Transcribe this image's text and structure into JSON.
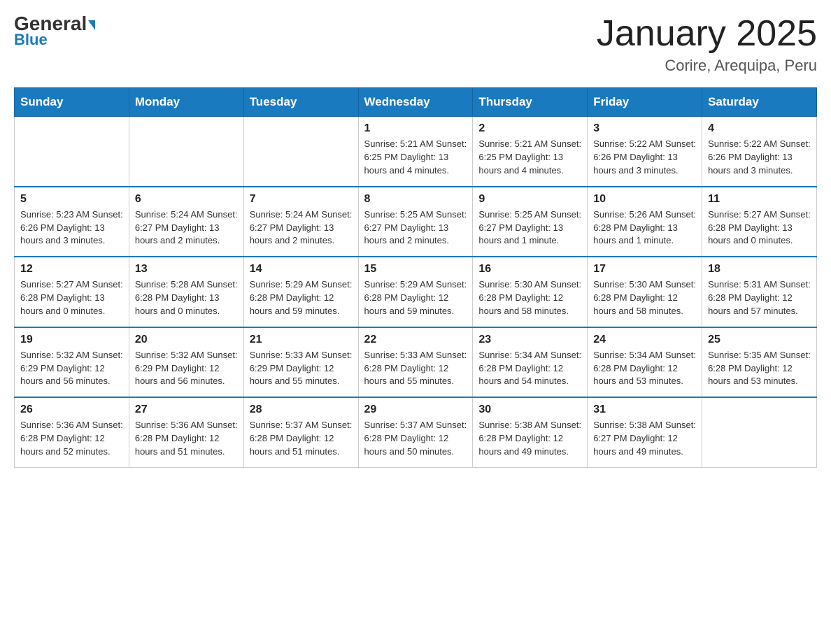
{
  "header": {
    "logo_general": "General",
    "logo_blue": "Blue",
    "month_title": "January 2025",
    "location": "Corire, Arequipa, Peru"
  },
  "days_of_week": [
    "Sunday",
    "Monday",
    "Tuesday",
    "Wednesday",
    "Thursday",
    "Friday",
    "Saturday"
  ],
  "weeks": [
    [
      {
        "day": "",
        "info": ""
      },
      {
        "day": "",
        "info": ""
      },
      {
        "day": "",
        "info": ""
      },
      {
        "day": "1",
        "info": "Sunrise: 5:21 AM\nSunset: 6:25 PM\nDaylight: 13 hours and 4 minutes."
      },
      {
        "day": "2",
        "info": "Sunrise: 5:21 AM\nSunset: 6:25 PM\nDaylight: 13 hours and 4 minutes."
      },
      {
        "day": "3",
        "info": "Sunrise: 5:22 AM\nSunset: 6:26 PM\nDaylight: 13 hours and 3 minutes."
      },
      {
        "day": "4",
        "info": "Sunrise: 5:22 AM\nSunset: 6:26 PM\nDaylight: 13 hours and 3 minutes."
      }
    ],
    [
      {
        "day": "5",
        "info": "Sunrise: 5:23 AM\nSunset: 6:26 PM\nDaylight: 13 hours and 3 minutes."
      },
      {
        "day": "6",
        "info": "Sunrise: 5:24 AM\nSunset: 6:27 PM\nDaylight: 13 hours and 2 minutes."
      },
      {
        "day": "7",
        "info": "Sunrise: 5:24 AM\nSunset: 6:27 PM\nDaylight: 13 hours and 2 minutes."
      },
      {
        "day": "8",
        "info": "Sunrise: 5:25 AM\nSunset: 6:27 PM\nDaylight: 13 hours and 2 minutes."
      },
      {
        "day": "9",
        "info": "Sunrise: 5:25 AM\nSunset: 6:27 PM\nDaylight: 13 hours and 1 minute."
      },
      {
        "day": "10",
        "info": "Sunrise: 5:26 AM\nSunset: 6:28 PM\nDaylight: 13 hours and 1 minute."
      },
      {
        "day": "11",
        "info": "Sunrise: 5:27 AM\nSunset: 6:28 PM\nDaylight: 13 hours and 0 minutes."
      }
    ],
    [
      {
        "day": "12",
        "info": "Sunrise: 5:27 AM\nSunset: 6:28 PM\nDaylight: 13 hours and 0 minutes."
      },
      {
        "day": "13",
        "info": "Sunrise: 5:28 AM\nSunset: 6:28 PM\nDaylight: 13 hours and 0 minutes."
      },
      {
        "day": "14",
        "info": "Sunrise: 5:29 AM\nSunset: 6:28 PM\nDaylight: 12 hours and 59 minutes."
      },
      {
        "day": "15",
        "info": "Sunrise: 5:29 AM\nSunset: 6:28 PM\nDaylight: 12 hours and 59 minutes."
      },
      {
        "day": "16",
        "info": "Sunrise: 5:30 AM\nSunset: 6:28 PM\nDaylight: 12 hours and 58 minutes."
      },
      {
        "day": "17",
        "info": "Sunrise: 5:30 AM\nSunset: 6:28 PM\nDaylight: 12 hours and 58 minutes."
      },
      {
        "day": "18",
        "info": "Sunrise: 5:31 AM\nSunset: 6:28 PM\nDaylight: 12 hours and 57 minutes."
      }
    ],
    [
      {
        "day": "19",
        "info": "Sunrise: 5:32 AM\nSunset: 6:29 PM\nDaylight: 12 hours and 56 minutes."
      },
      {
        "day": "20",
        "info": "Sunrise: 5:32 AM\nSunset: 6:29 PM\nDaylight: 12 hours and 56 minutes."
      },
      {
        "day": "21",
        "info": "Sunrise: 5:33 AM\nSunset: 6:29 PM\nDaylight: 12 hours and 55 minutes."
      },
      {
        "day": "22",
        "info": "Sunrise: 5:33 AM\nSunset: 6:28 PM\nDaylight: 12 hours and 55 minutes."
      },
      {
        "day": "23",
        "info": "Sunrise: 5:34 AM\nSunset: 6:28 PM\nDaylight: 12 hours and 54 minutes."
      },
      {
        "day": "24",
        "info": "Sunrise: 5:34 AM\nSunset: 6:28 PM\nDaylight: 12 hours and 53 minutes."
      },
      {
        "day": "25",
        "info": "Sunrise: 5:35 AM\nSunset: 6:28 PM\nDaylight: 12 hours and 53 minutes."
      }
    ],
    [
      {
        "day": "26",
        "info": "Sunrise: 5:36 AM\nSunset: 6:28 PM\nDaylight: 12 hours and 52 minutes."
      },
      {
        "day": "27",
        "info": "Sunrise: 5:36 AM\nSunset: 6:28 PM\nDaylight: 12 hours and 51 minutes."
      },
      {
        "day": "28",
        "info": "Sunrise: 5:37 AM\nSunset: 6:28 PM\nDaylight: 12 hours and 51 minutes."
      },
      {
        "day": "29",
        "info": "Sunrise: 5:37 AM\nSunset: 6:28 PM\nDaylight: 12 hours and 50 minutes."
      },
      {
        "day": "30",
        "info": "Sunrise: 5:38 AM\nSunset: 6:28 PM\nDaylight: 12 hours and 49 minutes."
      },
      {
        "day": "31",
        "info": "Sunrise: 5:38 AM\nSunset: 6:27 PM\nDaylight: 12 hours and 49 minutes."
      },
      {
        "day": "",
        "info": ""
      }
    ]
  ]
}
